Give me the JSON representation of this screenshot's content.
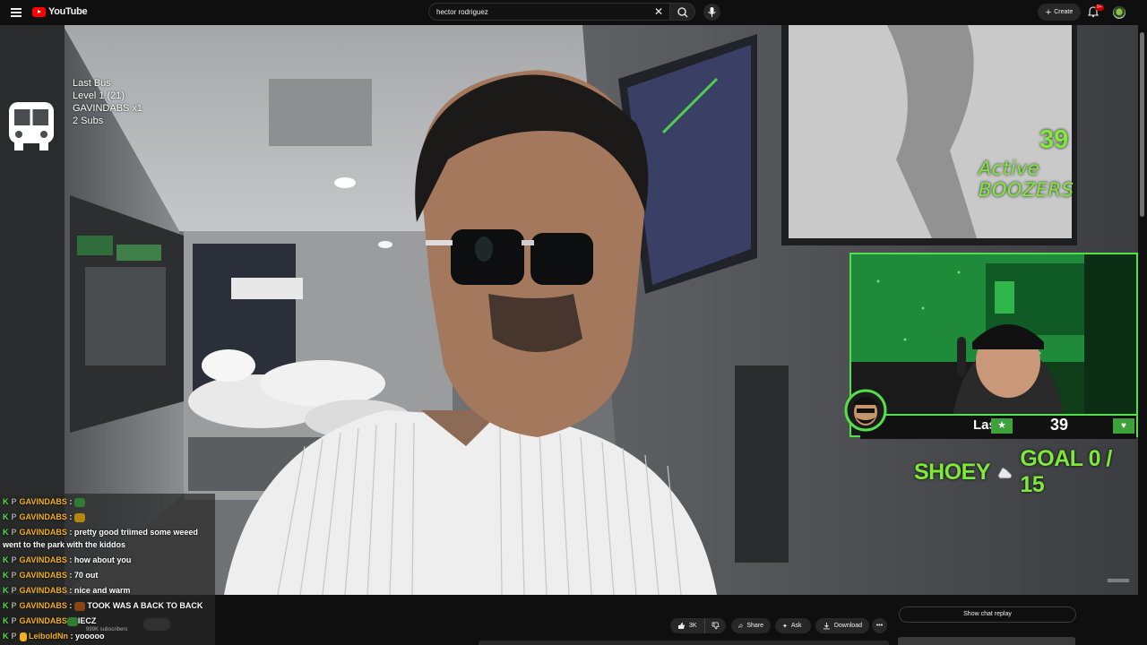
{
  "header": {
    "logo_text": "YouTube",
    "search_value": "hector rodriguez",
    "create_label": "Create",
    "notifications_badge": "9+"
  },
  "overlay": {
    "bus_title": "Last Bus",
    "bus_level": "Level 1  (21)",
    "bus_top": "GAVINDABS x1",
    "bus_subs": "2 Subs",
    "boozers_count": "39",
    "boozers_label": "Active BOOZERS",
    "cam_name": "Las",
    "cam_number": "39",
    "goal_left": "SHOEY",
    "goal_right": "GOAL  0 / 15"
  },
  "chat": {
    "messages": [
      {
        "user": "GAVINDABS",
        "text": "",
        "emote_color": "#2e7d32"
      },
      {
        "user": "GAVINDABS",
        "text": "",
        "emote_color": "#b8860b"
      },
      {
        "user": "GAVINDABS",
        "text": "pretty good triimed some weeed",
        "emote_color": ""
      },
      {
        "user": "",
        "text": "went to the park with the kiddos",
        "emote_color": ""
      },
      {
        "user": "GAVINDABS",
        "text": "how about you",
        "emote_color": ""
      },
      {
        "user": "GAVINDABS",
        "text": "70 out",
        "emote_color": ""
      },
      {
        "user": "GAVINDABS",
        "text": "nice and warm",
        "emote_color": ""
      },
      {
        "user": "GAVINDABS",
        "text": "TOOK WAS A BACK TO BACK",
        "emote_color": "#8b4513"
      },
      {
        "user": "GAVINDABS",
        "text": "IECZ",
        "emote_color": "#2e7d32"
      },
      {
        "user": "LeiboldNn",
        "text": "yooooo",
        "emote_color": ""
      }
    ],
    "subscribers_ghost": "999K subscribers"
  },
  "actions": {
    "like_count": "3K",
    "share_label": "Share",
    "ask_label": "Ask",
    "download_label": "Download",
    "replay_label": "Show chat replay"
  },
  "colors": {
    "accent_green": "#7fe93a",
    "cam_border": "#52e14b",
    "username": "#f2b01e",
    "youtube_red": "#ff0000"
  }
}
